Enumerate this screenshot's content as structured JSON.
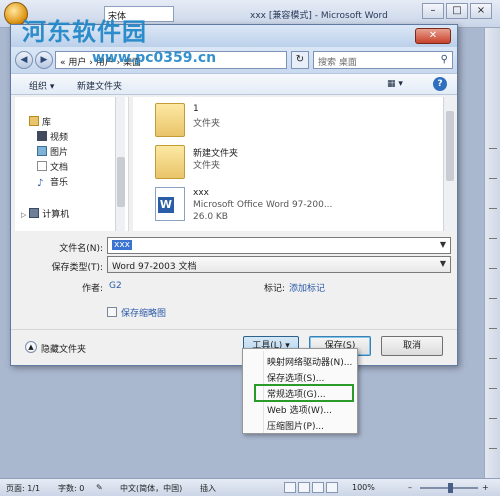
{
  "word": {
    "title": "xxx [兼容模式] - Microsoft Word",
    "qat_font": "宋体",
    "watermark": "河东软件园",
    "watermark_url": "www.pc0359.cn"
  },
  "dialog": {
    "address": "« 用户 › 用户 › 桌面",
    "search_placeholder": "搜索 桌面",
    "toolbar": {
      "organize": "组织 ▾",
      "new_folder": "新建文件夹"
    },
    "nav": {
      "items": [
        {
          "label": "库"
        },
        {
          "label": "视频"
        },
        {
          "label": "图片"
        },
        {
          "label": "文档"
        },
        {
          "label": "音乐"
        },
        {
          "label": "计算机"
        }
      ]
    },
    "files": [
      {
        "name": "1",
        "type": "文件夹",
        "size": ""
      },
      {
        "name": "新建文件夹",
        "type": "文件夹",
        "size": ""
      },
      {
        "name": "xxx",
        "type": "Microsoft Office Word 97-200...",
        "size": "26.0 KB"
      }
    ],
    "form": {
      "filename_label": "文件名(N):",
      "filename_value": "xxx",
      "savetype_label": "保存类型(T):",
      "savetype_value": "Word 97-2003 文档",
      "author_label": "作者:",
      "author_value": "G2",
      "tags_label": "标记:",
      "tags_value": "添加标记",
      "thumbnail_label": "保存缩略图"
    },
    "footer": {
      "hide_folders": "隐藏文件夹",
      "tools": "工具(L)",
      "save": "保存(S)",
      "cancel": "取消"
    }
  },
  "tools_menu": {
    "items": [
      {
        "label": "映射网络驱动器(N)..."
      },
      {
        "label": "保存选项(S)..."
      },
      {
        "label": "常规选项(G)..."
      },
      {
        "label": "Web 选项(W)..."
      },
      {
        "label": "压缩图片(P)..."
      }
    ]
  },
  "status": {
    "page": "页面: 1/1",
    "words": "字数: 0",
    "language": "中文(简体，中国)",
    "mode": "插入",
    "zoom": "100%"
  },
  "colors": {
    "highlight": "#2a9a2a",
    "link": "#2a5aa8",
    "selection": "#3a73d0"
  }
}
